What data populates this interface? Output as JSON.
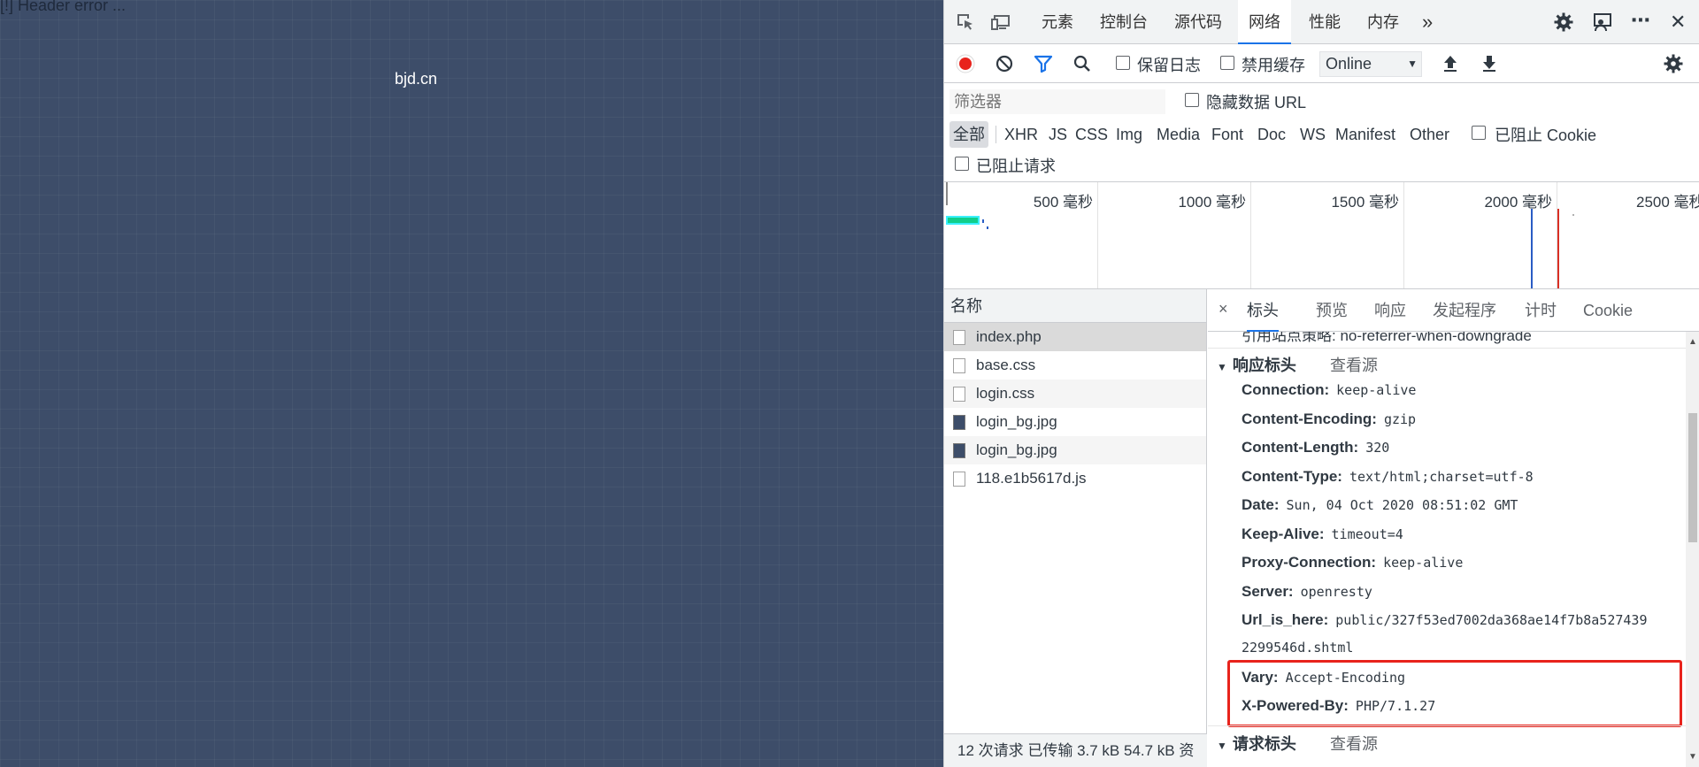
{
  "page": {
    "error_text": "[!] Header error ...",
    "site_text": "bjd.cn"
  },
  "devtools": {
    "main_tabs": [
      "元素",
      "控制台",
      "源代码",
      "网络",
      "性能",
      "内存"
    ],
    "more_tabs": "»",
    "active_tab": "网络",
    "toolbar": {
      "preserve_log": "保留日志",
      "disable_cache": "禁用缓存",
      "throttle_value": "Online"
    },
    "filter": {
      "placeholder": "筛选器",
      "hide_data_url": "隐藏数据 URL",
      "types": [
        "全部",
        "XHR",
        "JS",
        "CSS",
        "Img",
        "Media",
        "Font",
        "Doc",
        "WS",
        "Manifest",
        "Other"
      ],
      "blocked_cookies": "已阻止 Cookie",
      "blocked_requests": "已阻止请求"
    },
    "timeline": {
      "ticks": [
        "500 毫秒",
        "1000 毫秒",
        "1500 毫秒",
        "2000 毫秒",
        "2500 毫秒"
      ]
    },
    "request_list": {
      "header": "名称",
      "rows": [
        {
          "name": "index.php",
          "type": "doc"
        },
        {
          "name": "base.css",
          "type": "doc"
        },
        {
          "name": "login.css",
          "type": "doc"
        },
        {
          "name": "login_bg.jpg",
          "type": "img"
        },
        {
          "name": "login_bg.jpg",
          "type": "img"
        },
        {
          "name": "118.e1b5617d.js",
          "type": "doc"
        }
      ],
      "status": "12 次请求  已传输 3.7 kB  54.7 kB 资"
    },
    "details": {
      "close": "×",
      "tabs": [
        "标头",
        "预览",
        "响应",
        "发起程序",
        "计时",
        "Cookie"
      ],
      "partial_row": "引用站点策略: no-referrer-when-downgrade",
      "response_section": "响应标头",
      "request_section": "请求标头",
      "view_source": "查看源",
      "headers": [
        {
          "k": "Connection:",
          "v": "keep-alive"
        },
        {
          "k": "Content-Encoding:",
          "v": "gzip"
        },
        {
          "k": "Content-Length:",
          "v": "320"
        },
        {
          "k": "Content-Type:",
          "v": "text/html;charset=utf-8"
        },
        {
          "k": "Date:",
          "v": "Sun, 04 Oct 2020 08:51:02 GMT"
        },
        {
          "k": "Keep-Alive:",
          "v": "timeout=4"
        },
        {
          "k": "Proxy-Connection:",
          "v": "keep-alive"
        },
        {
          "k": "Server:",
          "v": "openresty"
        },
        {
          "k": "Url_is_here:",
          "v": "public/327f53ed7002da368ae14f7b8a527439",
          "v2": "2299546d.shtml"
        },
        {
          "k": "Vary:",
          "v": "Accept-Encoding"
        },
        {
          "k": "X-Powered-By:",
          "v": "PHP/7.1.27"
        }
      ]
    }
  }
}
